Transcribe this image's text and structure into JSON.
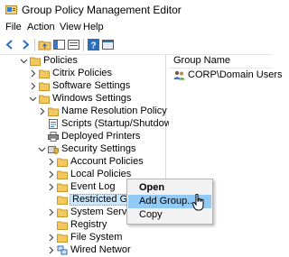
{
  "window": {
    "title": "Group Policy Management Editor"
  },
  "menu": {
    "items": [
      "File",
      "Action",
      "View",
      "Help"
    ]
  },
  "toolbar": {
    "buttons": [
      "back-icon",
      "forward-icon",
      "folder-up-icon",
      "show-hide-tree-icon",
      "properties-icon",
      "help-icon",
      "console-icon"
    ]
  },
  "tree": {
    "nodes": [
      {
        "label": "Policies",
        "level": 0,
        "expanded": true
      },
      {
        "label": "Citrix Policies",
        "level": 1,
        "expanded": false
      },
      {
        "label": "Software Settings",
        "level": 1,
        "expanded": false
      },
      {
        "label": "Windows Settings",
        "level": 1,
        "expanded": true
      },
      {
        "label": "Name Resolution Policy",
        "level": 2,
        "expanded": false
      },
      {
        "label": "Scripts (Startup/Shutdown)",
        "level": 2,
        "expanded": null
      },
      {
        "label": "Deployed Printers",
        "level": 2,
        "expanded": null
      },
      {
        "label": "Security Settings",
        "level": 2,
        "expanded": true
      },
      {
        "label": "Account Policies",
        "level": 3,
        "expanded": false
      },
      {
        "label": "Local Policies",
        "level": 3,
        "expanded": false
      },
      {
        "label": "Event Log",
        "level": 3,
        "expanded": false
      },
      {
        "label": "Restricted Groups",
        "level": 3,
        "expanded": null,
        "selected": true
      },
      {
        "label": "System Servic",
        "level": 3,
        "expanded": false
      },
      {
        "label": "Registry",
        "level": 3,
        "expanded": null
      },
      {
        "label": "File System",
        "level": 3,
        "expanded": false
      },
      {
        "label": "Wired Networ",
        "level": 3,
        "expanded": false
      }
    ]
  },
  "right_pane": {
    "column_header": "Group Name",
    "rows": [
      "CORP\\Domain Users"
    ]
  },
  "context_menu": {
    "items": [
      "Open",
      "Add Group...",
      "Copy"
    ],
    "highlighted": "Add Group..."
  }
}
